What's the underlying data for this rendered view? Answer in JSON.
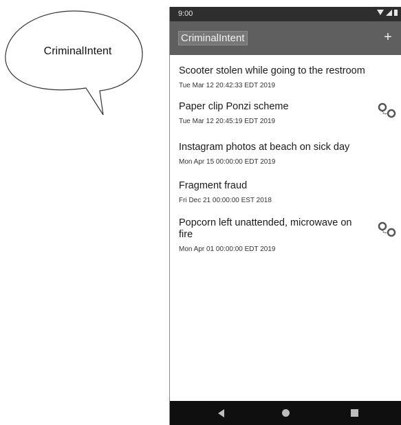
{
  "callout": {
    "text": "CriminalIntent"
  },
  "status_bar": {
    "time": "9:00",
    "icons": [
      "wifi-icon",
      "signal-icon",
      "battery-icon"
    ]
  },
  "toolbar": {
    "title": "CriminalIntent",
    "add_label": "+"
  },
  "crimes": [
    {
      "title": "Scooter stolen while going to the restroom",
      "date": "Tue Mar 12 20:42:33 EDT 2019",
      "solved": false
    },
    {
      "title": "Paper clip Ponzi scheme",
      "date": "Tue Mar 12 20:45:19 EDT 2019",
      "solved": true
    },
    {
      "title": "Instagram photos at beach on sick day",
      "date": "Mon Apr 15 00:00:00 EDT 2019",
      "solved": false
    },
    {
      "title": "Fragment fraud",
      "date": "Fri Dec 21 00:00:00 EST 2018",
      "solved": false
    },
    {
      "title": "Popcorn left unattended, microwave on fire",
      "date": "Mon Apr 01 00:00:00 EDT 2019",
      "solved": true
    }
  ],
  "nav_bar": {
    "icons": [
      "back-icon",
      "home-icon",
      "recents-icon"
    ]
  },
  "colors": {
    "toolbar": "#5f5f5f",
    "status_bar": "#2e2e2e",
    "nav_bar": "#0f0f0f"
  }
}
